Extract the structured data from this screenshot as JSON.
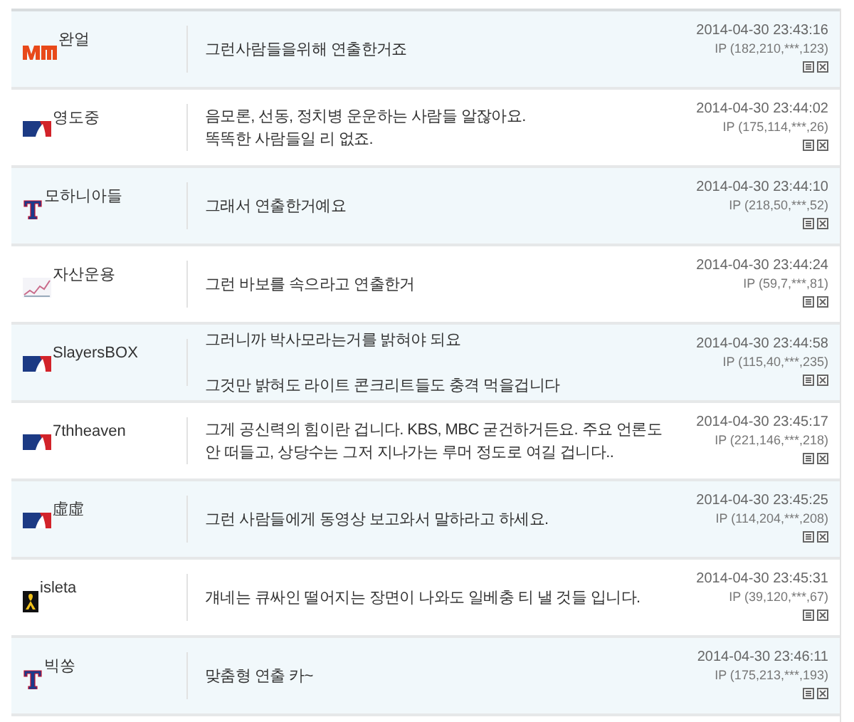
{
  "comments": [
    {
      "author": "완얼",
      "kind": "vm",
      "message": [
        {
          "text": "그런사람들을위해 연출한거죠",
          "kind": "line"
        }
      ],
      "date": "2014-04-30 23:43:16",
      "ip": "IP (182,210,***,123)"
    },
    {
      "author": "영도중",
      "kind": "mlb",
      "message": [
        {
          "text": "음모론, 선동, 정치병 운운하는 사람들 알잖아요.",
          "kind": "line"
        },
        {
          "text": "똑똑한 사람들일 리 없죠.",
          "kind": "line"
        }
      ],
      "date": "2014-04-30 23:44:02",
      "ip": "IP (175,114,***,26)"
    },
    {
      "author": "모하니아들",
      "kind": "t",
      "message": [
        {
          "text": "그래서 연출한거예요",
          "kind": "line"
        }
      ],
      "date": "2014-04-30 23:44:10",
      "ip": "IP (218,50,***,52)"
    },
    {
      "author": "자산운용",
      "kind": "chart",
      "message": [
        {
          "text": "그런 바보를 속으라고 연출한거",
          "kind": "line"
        }
      ],
      "date": "2014-04-30 23:44:24",
      "ip": "IP (59,7,***,81)"
    },
    {
      "author": "SlayersBOX",
      "kind": "mlb",
      "message": [
        {
          "text": "그러니까 박사모라는거를 밝혀야 되요",
          "kind": "line"
        },
        {
          "text": "그것만 밝혀도 라이트 콘크리트들도 충격 먹을겁니다",
          "kind": "paragraph"
        }
      ],
      "date": "2014-04-30 23:44:58",
      "ip": "IP (115,40,***,235)"
    },
    {
      "author": "7thheaven",
      "kind": "mlb",
      "message": [
        {
          "text": "그게 공신력의 힘이란 겁니다. KBS, MBC 굳건하거든요. 주요 언론도 안 떠들고, 상당수는 그저 지나가는 루머 정도로 여길 겁니다..",
          "kind": "line"
        }
      ],
      "date": "2014-04-30 23:45:17",
      "ip": "IP (221,146,***,218)"
    },
    {
      "author": "虛虛",
      "kind": "mlb",
      "message": [
        {
          "text": "그런 사람들에게 동영상 보고와서 말하라고 하세요.",
          "kind": "line"
        }
      ],
      "date": "2014-04-30 23:45:25",
      "ip": "IP (114,204,***,208)"
    },
    {
      "author": "isleta",
      "kind": "ribbon",
      "message": [
        {
          "text": "걔네는 큐싸인 떨어지는 장면이 나와도 일베충 티 낼 것들 입니다.",
          "kind": "line"
        }
      ],
      "date": "2014-04-30 23:45:31",
      "ip": "IP (39,120,***,67)"
    },
    {
      "author": "빅쏭",
      "kind": "t",
      "message": [
        {
          "text": "맞춤형 연출 카~",
          "kind": "line"
        }
      ],
      "date": "2014-04-30 23:46:11",
      "ip": "IP (175,213,***,193)"
    }
  ]
}
